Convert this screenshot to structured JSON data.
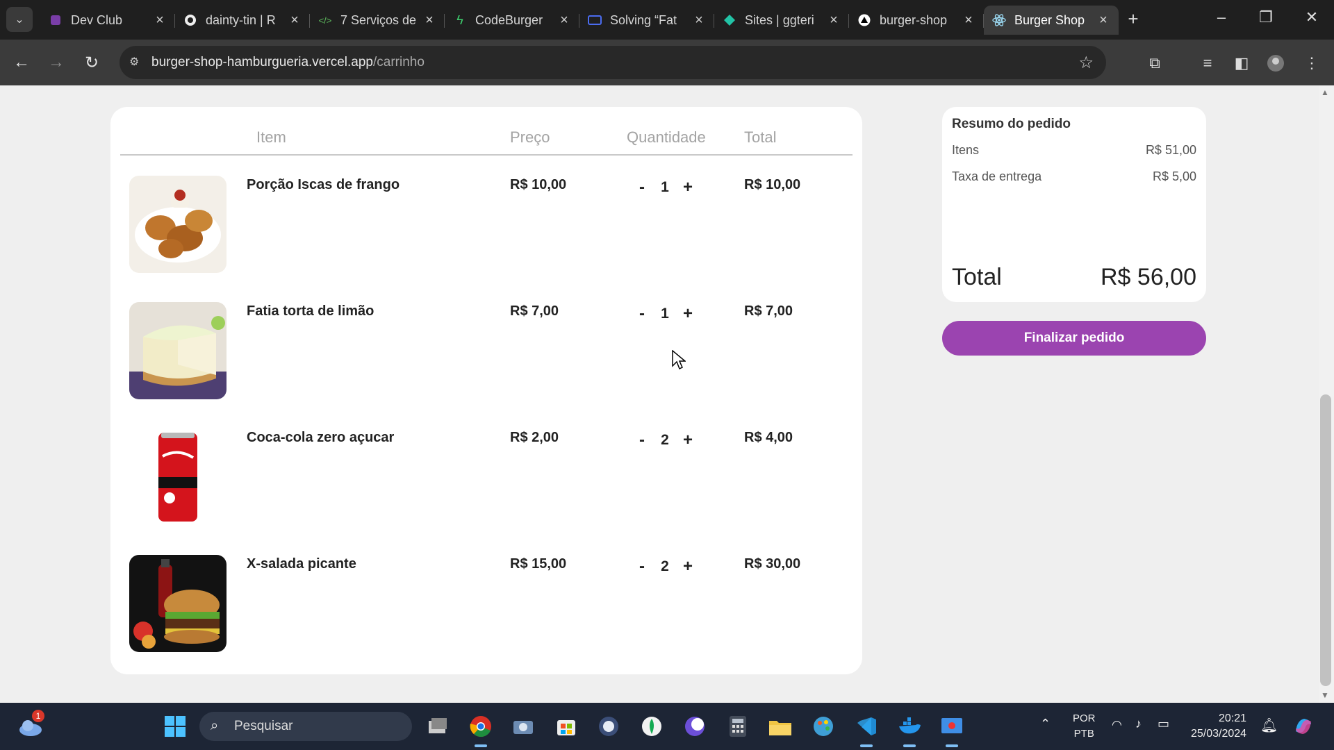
{
  "browser": {
    "tabs": [
      {
        "title": "Dev Club",
        "icon": "devclub-icon"
      },
      {
        "title": "dainty-tin | R",
        "icon": "github-icon"
      },
      {
        "title": "7 Serviços de",
        "icon": "code-icon"
      },
      {
        "title": "CodeBurger",
        "icon": "bolt-icon"
      },
      {
        "title": "Solving “Fat",
        "icon": "message-icon"
      },
      {
        "title": "Sites | ggteri",
        "icon": "diamond-icon"
      },
      {
        "title": "burger-shop",
        "icon": "vercel-icon"
      },
      {
        "title": "Burger Shop",
        "icon": "react-icon",
        "active": true
      }
    ],
    "url_host": "burger-shop-hamburgueria.vercel.app",
    "url_path": "/carrinho"
  },
  "cart": {
    "headers": {
      "item": "Item",
      "price": "Preço",
      "quantity": "Quantidade",
      "total": "Total"
    },
    "items": [
      {
        "name": "Porção Iscas de frango",
        "price": "R$ 10,00",
        "quantity": "1",
        "total": "R$ 10,00",
        "image": "fried-chicken"
      },
      {
        "name": "Fatia torta de limão",
        "price": "R$ 7,00",
        "quantity": "1",
        "total": "R$ 7,00",
        "image": "lemon-pie"
      },
      {
        "name": "Coca-cola zero açucar",
        "price": "R$ 2,00",
        "quantity": "2",
        "total": "R$ 4,00",
        "image": "coke-can"
      },
      {
        "name": "X-salada picante",
        "price": "R$ 15,00",
        "quantity": "2",
        "total": "R$ 30,00",
        "image": "burger"
      }
    ],
    "minus": "-",
    "plus": "+"
  },
  "summary": {
    "title": "Resumo do pedido",
    "items_label": "Itens",
    "items_value": "R$ 51,00",
    "delivery_label": "Taxa de entrega",
    "delivery_value": "R$ 5,00",
    "total_label": "Total",
    "total_value": "R$ 56,00",
    "checkout_label": "Finalizar pedido"
  },
  "taskbar": {
    "search_placeholder": "Pesquisar",
    "lang_top": "POR",
    "lang_bottom": "PTB",
    "time": "20:21",
    "date": "25/03/2024",
    "weather_badge": "1"
  },
  "colors": {
    "accent": "#9b44b0",
    "card": "#ffffff",
    "page_bg": "#efefef"
  }
}
